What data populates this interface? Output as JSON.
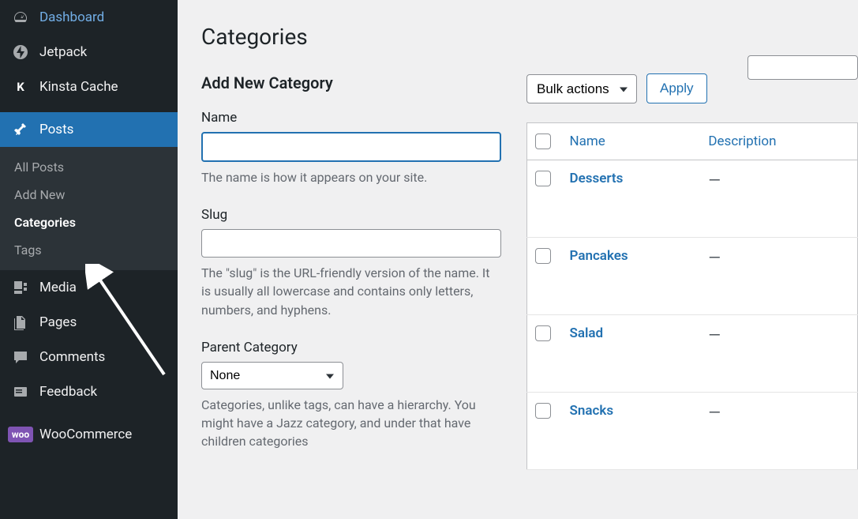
{
  "sidebar": {
    "items": [
      {
        "label": "Dashboard",
        "icon": "dashboard"
      },
      {
        "label": "Jetpack",
        "icon": "jetpack"
      },
      {
        "label": "Kinsta Cache",
        "icon": "kinsta"
      },
      {
        "label": "Posts",
        "icon": "pin",
        "active": true
      },
      {
        "label": "Media",
        "icon": "media"
      },
      {
        "label": "Pages",
        "icon": "pages"
      },
      {
        "label": "Comments",
        "icon": "comments"
      },
      {
        "label": "Feedback",
        "icon": "feedback"
      },
      {
        "label": "WooCommerce",
        "icon": "woo"
      }
    ],
    "submenu": [
      {
        "label": "All Posts"
      },
      {
        "label": "Add New"
      },
      {
        "label": "Categories",
        "current": true
      },
      {
        "label": "Tags"
      }
    ]
  },
  "page": {
    "title": "Categories"
  },
  "form": {
    "heading": "Add New Category",
    "name_label": "Name",
    "name_help": "The name is how it appears on your site.",
    "slug_label": "Slug",
    "slug_help": "The \"slug\" is the URL-friendly version of the name. It is usually all lowercase and contains only letters, numbers, and hyphens.",
    "parent_label": "Parent Category",
    "parent_value": "None",
    "parent_help": "Categories, unlike tags, can have a hierarchy. You might have a Jazz category, and under that have children categories"
  },
  "table": {
    "bulk_label": "Bulk actions",
    "apply_label": "Apply",
    "columns": {
      "name": "Name",
      "description": "Description"
    },
    "rows": [
      {
        "name": "Desserts",
        "description": "—"
      },
      {
        "name": "Pancakes",
        "description": "—"
      },
      {
        "name": "Salad",
        "description": "—"
      },
      {
        "name": "Snacks",
        "description": "—"
      }
    ]
  }
}
